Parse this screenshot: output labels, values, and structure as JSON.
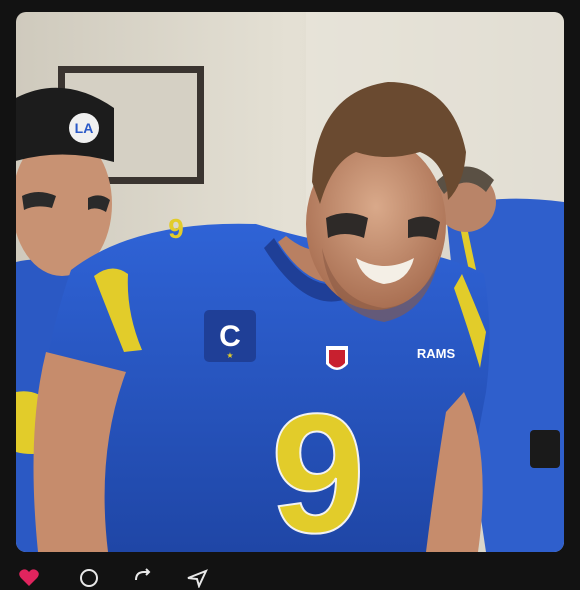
{
  "photo": {
    "description_visible_text": {
      "helmet_logo": "LA",
      "captain_patch": "C",
      "chest_wordmark": "RAMS",
      "jersey_number_front": "9",
      "jersey_number_sleeve": "9"
    },
    "colors": {
      "jersey_blue": "#2a59c8",
      "jersey_gold": "#e2cc2a",
      "background_wall": "#d9d4c6",
      "frame_background": "#121212"
    }
  },
  "actions": {
    "like_count": "",
    "icons": [
      "heart-icon",
      "comment-icon",
      "repost-icon",
      "share-icon"
    ]
  }
}
